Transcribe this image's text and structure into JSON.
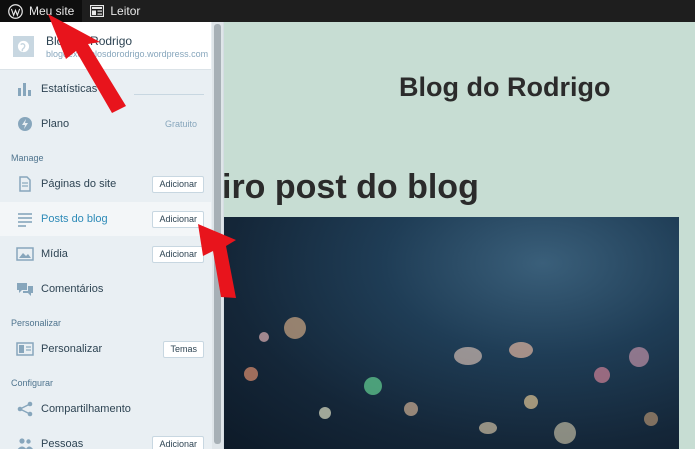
{
  "masterbar": {
    "my_site": "Meu site",
    "reader": "Leitor"
  },
  "sidebar": {
    "site_name": "Blog do Rodrigo",
    "site_url": "blogdexemplosdorodrigo.wordpress.com",
    "stats": "Estatísticas",
    "plan": "Plano",
    "plan_value": "Gratuito",
    "manage_heading": "Manage",
    "pages": "Páginas do site",
    "posts": "Posts do blog",
    "media": "Mídia",
    "comments": "Comentários",
    "personalize_heading": "Personalizar",
    "customize": "Personalizar",
    "themes": "Temas",
    "configure_heading": "Configurar",
    "sharing": "Compartilhamento",
    "people": "Pessoas",
    "add_label": "Adicionar"
  },
  "content": {
    "site_title": "Blog do Rodrigo",
    "post_title": "iro post do blog"
  },
  "colors": {
    "accent": "#2e8bb8",
    "arrow": "#e8141c",
    "masterbar": "#1e1e1e"
  }
}
